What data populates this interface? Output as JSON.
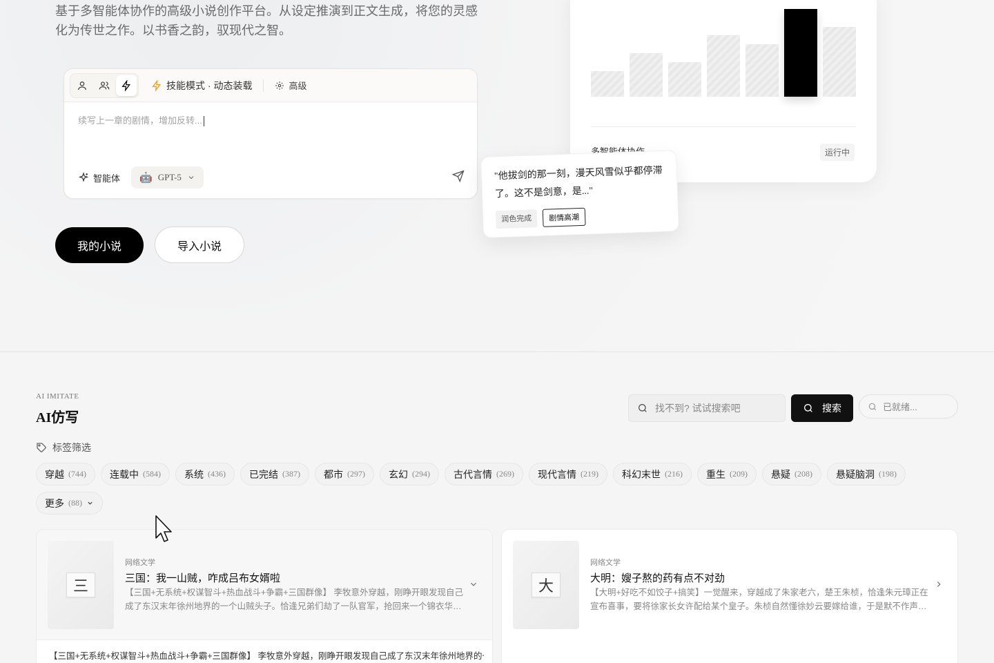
{
  "hero": {
    "description": "基于多智能体协作的高级小说创作平台。从设定推演到正文生成，将您的灵感化为传世之作。以书香之韵，驭现代之智。",
    "composer": {
      "mode_label": "技能模式 · 动态装载",
      "advanced_label": "高级",
      "input_text": "续写上一章的剧情，增加反转...",
      "agent_label": "智能体",
      "model": "GPT-5"
    },
    "primary_button": "我的小说",
    "secondary_button": "导入小说",
    "chart_card": {
      "footer_label": "多智能体协作",
      "status": "运行中"
    },
    "quote_card": {
      "text": "\"他拔剑的那一刻，漫天风雪似乎都停滞了。这不是剑意，是...\"",
      "tags": [
        "润色完成",
        "剧情高潮"
      ]
    }
  },
  "chart_data": {
    "type": "bar",
    "values": [
      37,
      63,
      50,
      89,
      76,
      127,
      101
    ],
    "highlight_index": 5,
    "ylim": [
      0,
      127
    ]
  },
  "section": {
    "kicker": "AI IMITATE",
    "title": "AI仿写",
    "search_placeholder": "找不到? 试试搜索吧",
    "search_button": "搜索",
    "status": "已就绪...",
    "filter_label": "标签筛选",
    "tags": [
      {
        "name": "穿越",
        "count": "(744)"
      },
      {
        "name": "连载中",
        "count": "(584)"
      },
      {
        "name": "系统",
        "count": "(436)"
      },
      {
        "name": "已完结",
        "count": "(387)"
      },
      {
        "name": "都市",
        "count": "(297)"
      },
      {
        "name": "玄幻",
        "count": "(294)"
      },
      {
        "name": "古代言情",
        "count": "(269)"
      },
      {
        "name": "现代言情",
        "count": "(219)"
      },
      {
        "name": "科幻末世",
        "count": "(216)"
      },
      {
        "name": "重生",
        "count": "(209)"
      },
      {
        "name": "悬疑",
        "count": "(208)"
      },
      {
        "name": "悬疑脑洞",
        "count": "(198)"
      },
      {
        "name": "更多",
        "count": "(88)"
      }
    ],
    "books": [
      {
        "cover_char": "三",
        "category": "网络文学",
        "title": "三国：我一山贼，咋成吕布女婿啦",
        "intro": "【三国+无系统+权谋智斗+热血战斗+争霸+三国群像】 李牧意外穿越，刚睁开眼发现自己成了东汉末年徐州地界的一个山贼头子。恰逢兄弟们劫了一队官军，抢回来一个锦衣华服的...",
        "expanded": "【三国+无系统+权谋智斗+热血战斗+争霸+三国群像】 李牧意外穿越，刚睁开眼发现自己成了东汉末年徐州地界的一个"
      },
      {
        "cover_char": "大",
        "category": "网络文学",
        "title": "大明：嫂子熬的药有点不对劲",
        "intro": "【大明+好吃不如饺子+搞笑】一觉醒来，穿越成了朱家老六，楚王朱桢，恰逢朱元璋正在宣布喜事，要将徐家长女许配给某个皇子。朱桢自然懂徐妙云要嫁给谁，于是默不作声，不..."
      }
    ]
  }
}
